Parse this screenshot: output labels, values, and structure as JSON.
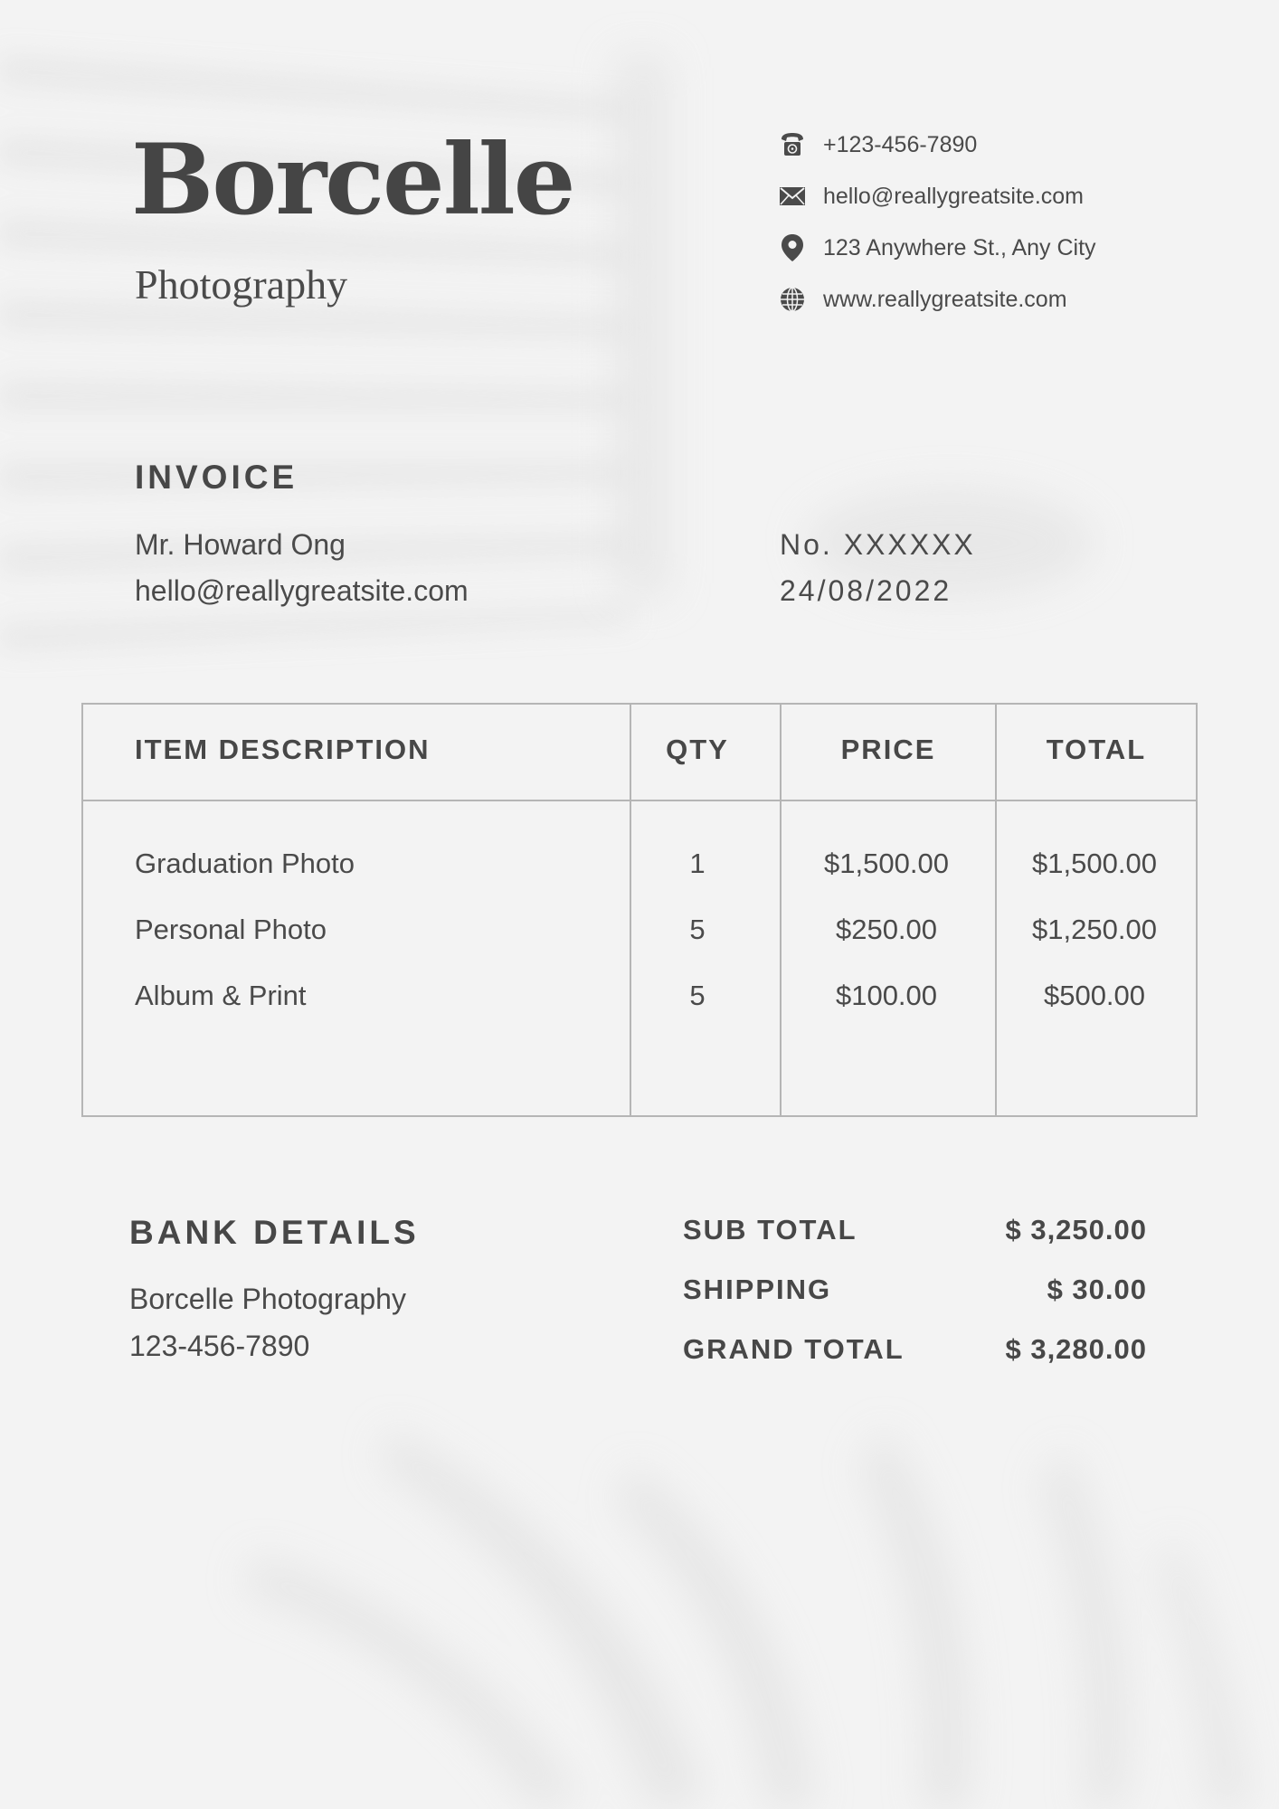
{
  "brand": {
    "name": "Borcelle",
    "subtitle": "Photography"
  },
  "contacts": [
    {
      "icon": "phone-icon",
      "text": "+123-456-7890"
    },
    {
      "icon": "mail-icon",
      "text": "hello@reallygreatsite.com"
    },
    {
      "icon": "location-pin-icon",
      "text": "123 Anywhere St., Any City"
    },
    {
      "icon": "globe-icon",
      "text": "www.reallygreatsite.com"
    }
  ],
  "invoice": {
    "title": "INVOICE",
    "customer_name": "Mr. Howard Ong",
    "customer_email": "hello@reallygreatsite.com",
    "number": "No. XXXXXX",
    "date": "24/08/2022"
  },
  "table": {
    "headers": [
      "ITEM DESCRIPTION",
      "QTY",
      "PRICE",
      "TOTAL"
    ],
    "rows": [
      {
        "description": "Graduation Photo",
        "qty": "1",
        "price": "$1,500.00",
        "total": "$1,500.00"
      },
      {
        "description": "Personal Photo",
        "qty": "5",
        "price": "$250.00",
        "total": "$1,250.00"
      },
      {
        "description": "Album & Print",
        "qty": "5",
        "price": "$100.00",
        "total": "$500.00"
      }
    ]
  },
  "bank": {
    "title": "BANK DETAILS",
    "account_name": "Borcelle Photography",
    "account_number": "123-456-7890"
  },
  "summary": [
    {
      "label": "SUB TOTAL",
      "value": "$ 3,250.00"
    },
    {
      "label": "SHIPPING",
      "value": "$ 30.00"
    },
    {
      "label": "GRAND TOTAL",
      "value": "$ 3,280.00"
    }
  ],
  "colors": {
    "background": "#f3f3f3",
    "text": "#444444",
    "border": "#b5b5b5"
  }
}
